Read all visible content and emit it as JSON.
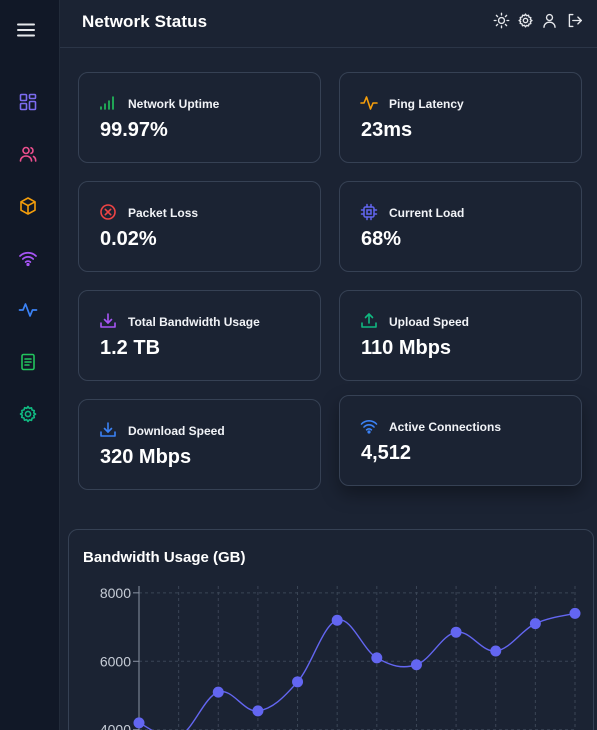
{
  "header": {
    "title": "Network Status",
    "icons": [
      "sun-icon",
      "gear-icon",
      "user-icon",
      "logout-icon"
    ]
  },
  "sidebar": {
    "menu_icon": "hamburger-icon",
    "items": [
      {
        "icon": "dashboard-grid-icon",
        "color": "#7c6cf0"
      },
      {
        "icon": "users-icon",
        "color": "#ec4f8e"
      },
      {
        "icon": "package-icon",
        "color": "#f59e0b"
      },
      {
        "icon": "wifi-icon",
        "color": "#a855f7"
      },
      {
        "icon": "activity-icon",
        "color": "#3b82f6"
      },
      {
        "icon": "document-icon",
        "color": "#22c55e"
      },
      {
        "icon": "settings-icon",
        "color": "#10b981"
      }
    ]
  },
  "cards": [
    {
      "label": "Network Uptime",
      "value": "99.97%",
      "icon": "signal-bars-icon",
      "color": "#22c55e"
    },
    {
      "label": "Ping Latency",
      "value": "23ms",
      "icon": "pulse-icon",
      "color": "#f59e0b"
    },
    {
      "label": "Packet Loss",
      "value": "0.02%",
      "icon": "x-circle-icon",
      "color": "#ef4444"
    },
    {
      "label": "Current Load",
      "value": "68%",
      "icon": "cpu-icon",
      "color": "#6366f1"
    },
    {
      "label": "Total Bandwidth Usage",
      "value": "1.2 TB",
      "icon": "download-tray-icon",
      "color": "#a855f7"
    },
    {
      "label": "Upload Speed",
      "value": "110 Mbps",
      "icon": "upload-tray-icon",
      "color": "#10b981"
    },
    {
      "label": "Download Speed",
      "value": "320 Mbps",
      "icon": "download-tray-icon",
      "color": "#3b82f6"
    },
    {
      "label": "Active Connections",
      "value": "4,512",
      "icon": "wifi-icon",
      "color": "#3b82f6"
    }
  ],
  "chart_data": {
    "type": "line",
    "title": "Bandwidth Usage (GB)",
    "xlabel": "",
    "ylabel": "",
    "y_ticks": [
      4000,
      6000,
      8000
    ],
    "ylim": [
      3700,
      8200
    ],
    "grid": true,
    "line_color": "#6366f1",
    "series": [
      {
        "values": [
          4200,
          3800,
          5100,
          4550,
          5400,
          7200,
          6100,
          5900,
          6850,
          6300,
          7100,
          7400
        ]
      }
    ]
  }
}
